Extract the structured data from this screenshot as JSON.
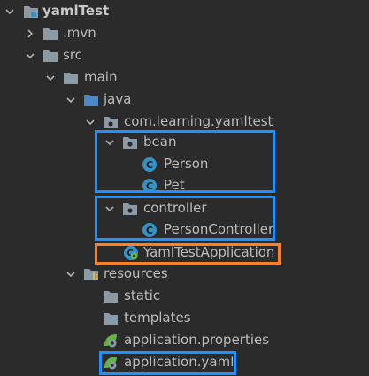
{
  "tree": {
    "project": {
      "label": "yamlTest",
      "icon": "project-folder-icon"
    },
    "mvn": {
      "label": ".mvn",
      "icon": "folder-icon"
    },
    "src": {
      "label": "src",
      "icon": "folder-icon"
    },
    "main": {
      "label": "main",
      "icon": "folder-icon"
    },
    "java": {
      "label": "java",
      "icon": "source-root-folder-icon"
    },
    "package": {
      "label": "com.learning.yamltest",
      "icon": "package-icon"
    },
    "bean": {
      "label": "bean",
      "icon": "package-icon"
    },
    "person": {
      "label": "Person",
      "icon": "class-icon"
    },
    "pet": {
      "label": "Pet",
      "icon": "class-icon"
    },
    "controller": {
      "label": "controller",
      "icon": "package-icon"
    },
    "person_controller": {
      "label": "PersonController",
      "icon": "class-icon"
    },
    "application_class": {
      "label": "YamlTestApplication",
      "icon": "spring-boot-class-icon"
    },
    "resources": {
      "label": "resources",
      "icon": "resources-folder-icon"
    },
    "static": {
      "label": "static",
      "icon": "folder-icon"
    },
    "templates": {
      "label": "templates",
      "icon": "folder-icon"
    },
    "app_properties": {
      "label": "application.properties",
      "icon": "spring-properties-icon"
    },
    "app_yaml": {
      "label": "application.yaml",
      "icon": "spring-yaml-icon"
    }
  },
  "colors": {
    "background": "#2b2b2b",
    "text": "#bbbbbb",
    "highlight_blue": "#1e90ff",
    "highlight_orange": "#ff7f27",
    "folder": "#8c9aa6",
    "source_folder": "#4a88c7",
    "class_icon": "#3592c4",
    "spring": "#62b543"
  }
}
